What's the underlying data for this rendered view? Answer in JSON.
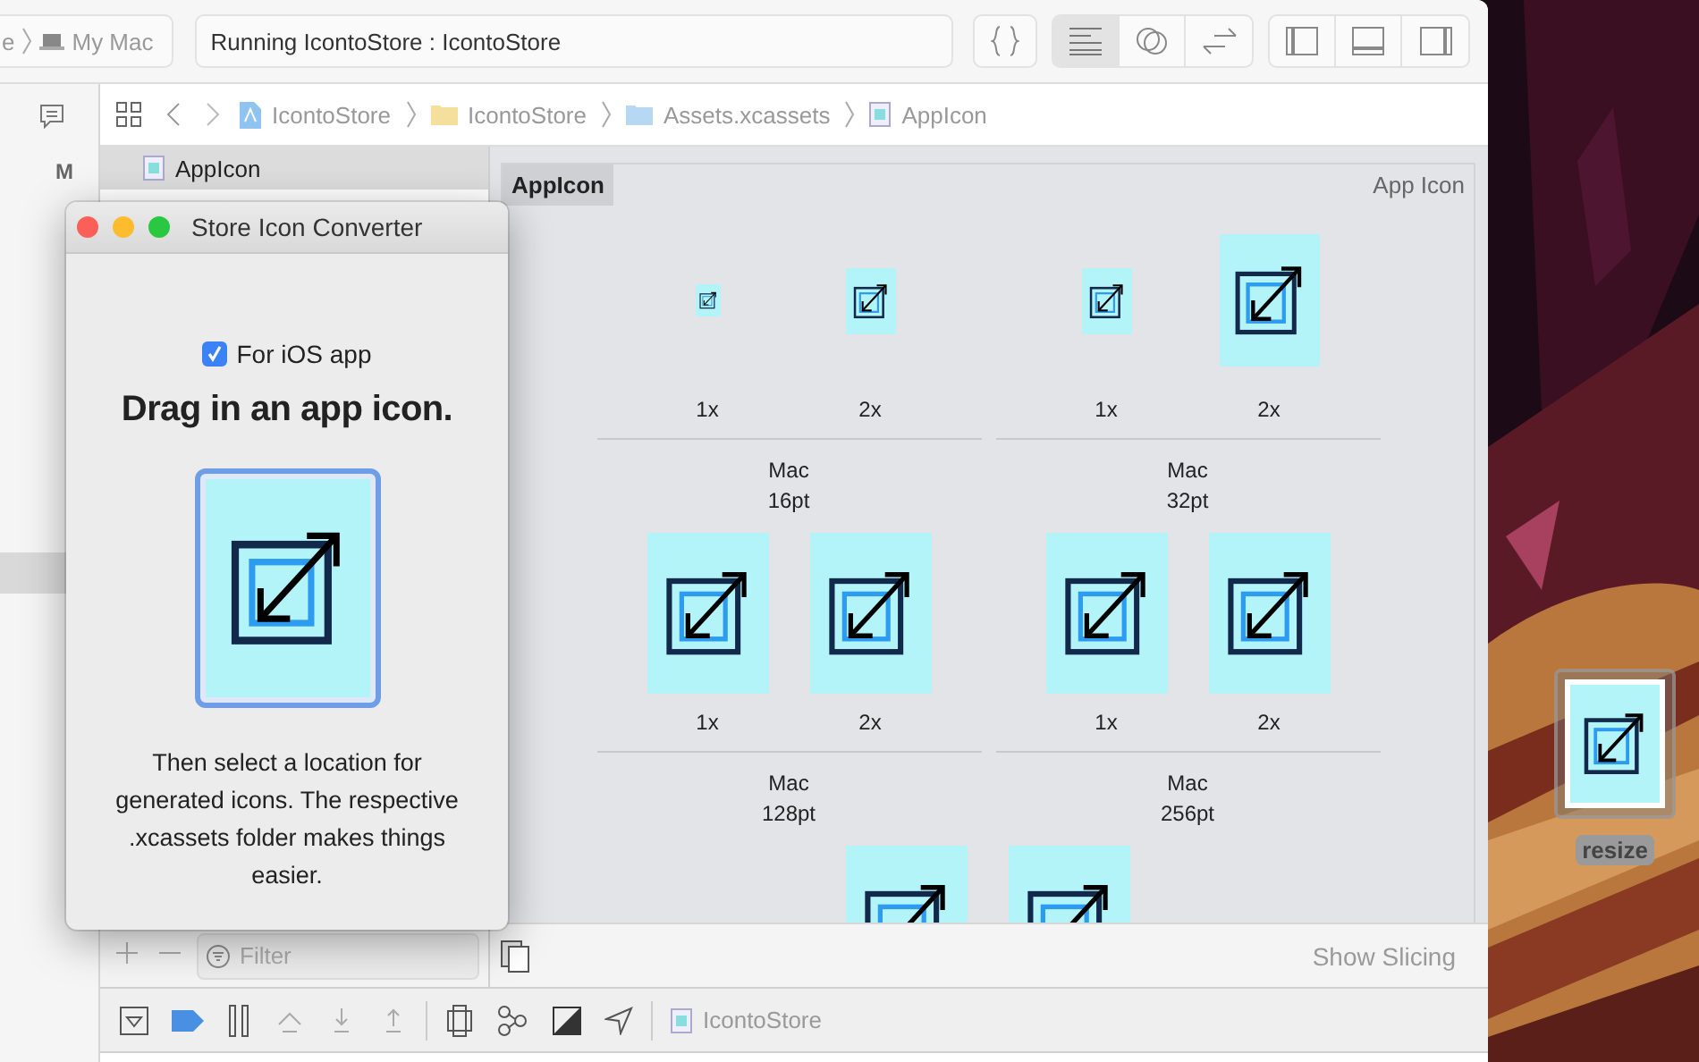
{
  "toolbar": {
    "scheme": {
      "target": "e",
      "destination": "My Mac"
    },
    "activity": "Running IcontoStore : IcontoStore",
    "editor_buttons": [
      {
        "kind": "braces",
        "selected": false
      },
      {
        "kind": "standard",
        "selected": true
      },
      {
        "kind": "assistant",
        "selected": false
      },
      {
        "kind": "version",
        "selected": false
      }
    ],
    "panel_buttons": [
      {
        "kind": "left"
      },
      {
        "kind": "bottom"
      },
      {
        "kind": "right"
      }
    ]
  },
  "navigator": {
    "markers": [
      {
        "label": "M",
        "selected": false
      },
      {
        "selected": true
      }
    ]
  },
  "jump_bar": {
    "crumbs": [
      {
        "kind": "project",
        "label": "IcontoStore"
      },
      {
        "kind": "folder",
        "label": "IcontoStore"
      },
      {
        "kind": "catalog",
        "label": "Assets.xcassets"
      },
      {
        "kind": "asset",
        "label": "AppIcon"
      }
    ]
  },
  "asset_list": {
    "items": [
      {
        "label": "AppIcon",
        "selected": true
      }
    ],
    "filter": {
      "placeholder": "Filter"
    }
  },
  "editor": {
    "title": "AppIcon",
    "type": "App Icon",
    "groups": [
      {
        "platform": "Mac",
        "size": "16pt",
        "slots": [
          {
            "scale": "1x",
            "filled": true
          },
          {
            "scale": "2x",
            "filled": true
          }
        ]
      },
      {
        "platform": "Mac",
        "size": "32pt",
        "slots": [
          {
            "scale": "1x",
            "filled": true
          },
          {
            "scale": "2x",
            "filled": true
          }
        ]
      },
      {
        "platform": "Mac",
        "size": "128pt",
        "slots": [
          {
            "scale": "1x",
            "filled": true
          },
          {
            "scale": "2x",
            "filled": true
          }
        ]
      },
      {
        "platform": "Mac",
        "size": "256pt",
        "slots": [
          {
            "scale": "1x",
            "filled": true
          },
          {
            "scale": "2x",
            "filled": true
          }
        ]
      },
      {
        "slots": [
          {
            "filled": true
          },
          {
            "filled": true
          }
        ]
      }
    ],
    "show_slicing": "Show Slicing"
  },
  "debug_bar": {
    "buttons": [
      {
        "kind": "console",
        "on": false
      },
      {
        "kind": "breakpoints",
        "on": true
      },
      {
        "kind": "pause",
        "on": false
      },
      {
        "kind": "step_over",
        "on": false
      },
      {
        "kind": "step_in",
        "on": false
      },
      {
        "kind": "step_out",
        "on": false
      },
      {
        "kind": "view_debug",
        "on": false
      },
      {
        "kind": "memory_graph",
        "on": false
      },
      {
        "kind": "environment",
        "on": false
      },
      {
        "kind": "location",
        "on": false
      }
    ],
    "target": "IcontoStore"
  },
  "converter_window": {
    "title": "Store Icon Converter",
    "for_ios": {
      "label": "For iOS app",
      "checked": true
    },
    "heading": "Drag in an app icon.",
    "instructions": "Then select a location for generated icons. The respective .xcassets folder makes things easier."
  },
  "desktop": {
    "icon": {
      "label": "resize",
      "selected": true
    }
  }
}
